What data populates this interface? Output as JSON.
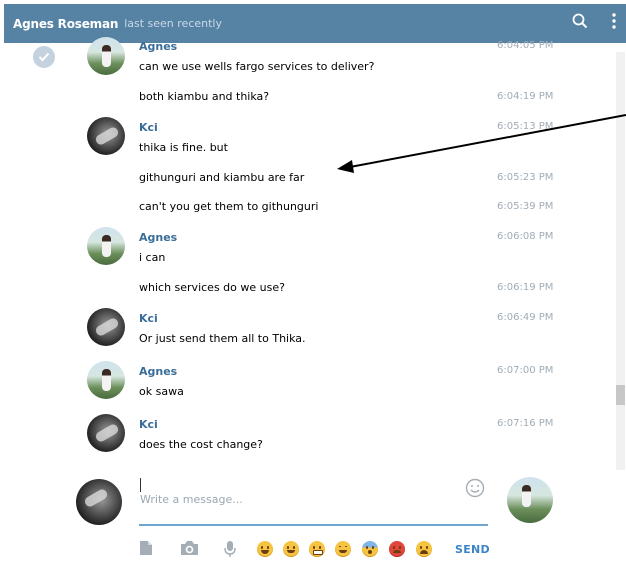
{
  "header": {
    "contact_name": "Agnes Roseman",
    "status": "last seen recently",
    "icons": [
      "search-icon",
      "more-vert-icon"
    ]
  },
  "messages": [
    {
      "sender": "Agnes",
      "text": "can we use wells fargo services to deliver?",
      "time": "6:04:05 PM"
    },
    {
      "sender": "",
      "text": "both kiambu and thika?",
      "time": "6:04:19 PM"
    },
    {
      "sender": "Kci",
      "text": "thika is fine. but",
      "time": "6:05:13 PM"
    },
    {
      "sender": "",
      "text": "githunguri and kiambu are far",
      "time": "6:05:23 PM"
    },
    {
      "sender": "",
      "text": "can't you get them to githunguri",
      "time": "6:05:39 PM"
    },
    {
      "sender": "Agnes",
      "text": "i can",
      "time": "6:06:08 PM"
    },
    {
      "sender": "",
      "text": "which services do we use?",
      "time": "6:06:19 PM"
    },
    {
      "sender": "Kci",
      "text": "Or just send them all to Thika.",
      "time": "6:06:49 PM"
    },
    {
      "sender": "Agnes",
      "text": "ok sawa",
      "time": "6:07:00 PM"
    },
    {
      "sender": "Kci",
      "text": "does the cost change?",
      "time": "6:07:16 PM"
    }
  ],
  "composer": {
    "placeholder": "Write a message...",
    "value": "",
    "send_label": "SEND",
    "tools": [
      "attach-file-icon",
      "camera-icon",
      "microphone-icon"
    ],
    "emojis": [
      "grinning-sweat-emoji",
      "smiley-emoji",
      "grimacing-emoji",
      "blush-emoji",
      "scream-emoji",
      "angry-emoji",
      "crying-emoji"
    ]
  },
  "colors": {
    "header_bg": "#5682a3",
    "sender_name": "#3a6d99",
    "timestamp": "#a0acb6",
    "input_underline": "#6ea6d0",
    "send": "#3a84c8"
  }
}
